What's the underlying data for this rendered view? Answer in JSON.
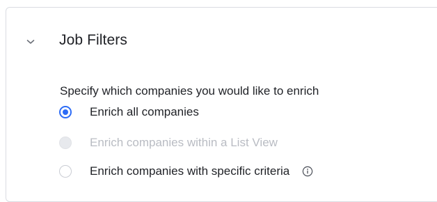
{
  "section": {
    "title": "Job Filters",
    "expanded": true
  },
  "prompt": "Specify which companies you would like to enrich",
  "options": [
    {
      "label": "Enrich all companies",
      "selected": true,
      "disabled": false
    },
    {
      "label": "Enrich companies within a List View",
      "selected": false,
      "disabled": true
    },
    {
      "label": "Enrich companies with specific criteria",
      "selected": false,
      "disabled": false,
      "has_info_icon": true
    }
  ],
  "colors": {
    "accent": "#2d6cf6",
    "text": "#1f2126",
    "disabled_text": "#b9bcc3",
    "border": "#dadce2"
  },
  "icons": {
    "collapse": "chevron-down-icon",
    "info": "info-icon"
  }
}
